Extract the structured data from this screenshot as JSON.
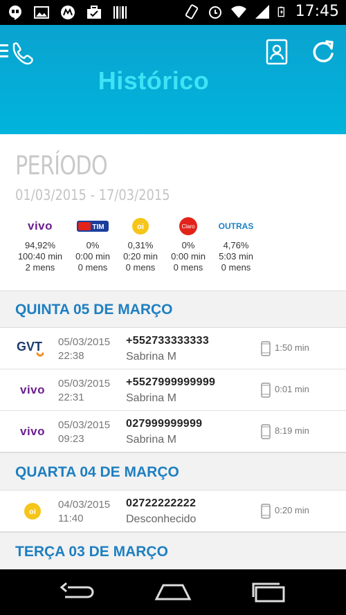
{
  "status_bar": {
    "time": "17:45",
    "left_icons": [
      "hangouts-icon",
      "image-icon",
      "motorola-icon",
      "briefcase-icon",
      "barcode-icon"
    ],
    "right_icons": [
      "vibrate-icon",
      "alarm-icon",
      "wifi-icon",
      "signal-icon",
      "battery-icon"
    ]
  },
  "header": {
    "title": "Histórico",
    "menu_icon": "menu-phone-icon",
    "contacts_icon": "contacts-icon",
    "refresh_icon": "refresh-icon",
    "background": "#00b4dc",
    "title_color": "#3fe3f6"
  },
  "period": {
    "label": "PERÍODO",
    "range": "01/03/2015 - 17/03/2015",
    "operators": [
      {
        "name": "vivo",
        "percent": "94,92%",
        "minutes": "100:40 min",
        "messages": "2 mens"
      },
      {
        "name": "TIM",
        "percent": "0%",
        "minutes": "0:00 min",
        "messages": "0 mens"
      },
      {
        "name": "oi",
        "percent": "0,31%",
        "minutes": "0:20 min",
        "messages": "0 mens"
      },
      {
        "name": "Claro",
        "percent": "0%",
        "minutes": "0:00 min",
        "messages": "0 mens"
      },
      {
        "name": "OUTRAS",
        "percent": "4,76%",
        "minutes": "5:03 min",
        "messages": "0 mens"
      }
    ]
  },
  "days": [
    {
      "label": "QUINTA 05 DE MARÇO",
      "calls": [
        {
          "operator": "GVT",
          "date": "05/03/2015",
          "time": "22:38",
          "number": "+552733333333",
          "name": "Sabrina M",
          "duration": "1:50 min"
        },
        {
          "operator": "vivo",
          "date": "05/03/2015",
          "time": "22:31",
          "number": "+5527999999999",
          "name": "Sabrina M",
          "duration": "0:01 min"
        },
        {
          "operator": "vivo",
          "date": "05/03/2015",
          "time": "09:23",
          "number": "027999999999",
          "name": "Sabrina M",
          "duration": "8:19 min"
        }
      ]
    },
    {
      "label": "QUARTA 04 DE MARÇO",
      "calls": [
        {
          "operator": "oi",
          "date": "04/03/2015",
          "time": "11:40",
          "number": "02722222222",
          "name": "Desconhecido",
          "duration": "0:20 min"
        }
      ]
    },
    {
      "label": "TERÇA 03 DE MARÇO",
      "calls": []
    }
  ],
  "nav": {
    "back_icon": "back-icon",
    "home_icon": "home-icon",
    "recents_icon": "recents-icon"
  }
}
